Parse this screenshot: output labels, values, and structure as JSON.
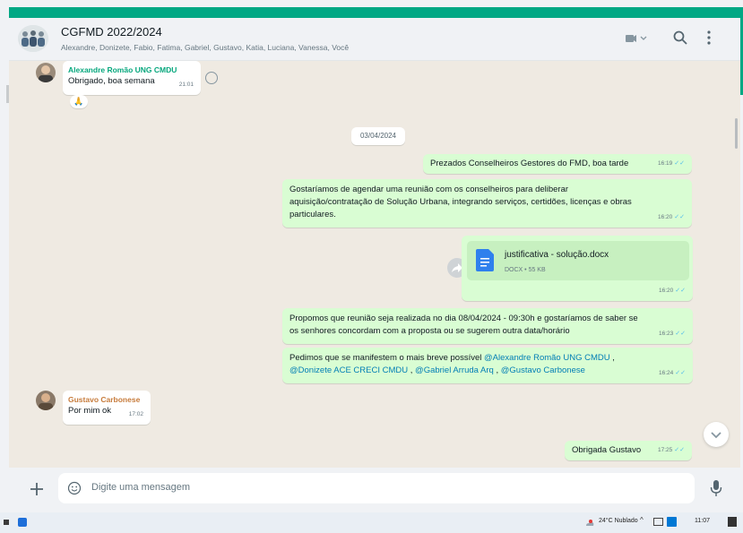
{
  "header": {
    "title": "CGFMD 2022/2024",
    "members": "Alexandre, Donizete, Fabio, Fatima, Gabriel, Gustavo, Katia, Luciana, Vanessa, Você",
    "icons": [
      "video-call-icon",
      "search-icon",
      "menu-icon"
    ]
  },
  "messages": [
    {
      "sender": "Alexandre Romão UNG CMDU",
      "sender_color": "#06a77d",
      "text": "Obrigado, boa semana",
      "time": "21:01",
      "direction": "in",
      "reaction": "🙏"
    },
    {
      "date": "03/04/2024"
    },
    {
      "text": "Prezados Conselheiros Gestores do FMD, boa tarde",
      "time": "16:19",
      "direction": "out"
    },
    {
      "text": "Gostaríamos de agendar uma reunião com os conselheiros para deliberar\naquisição/contratação de Solução Urbana, integrando serviços, certidões, licenças e obras\nparticulares.",
      "time": "16:20",
      "direction": "out"
    },
    {
      "doc_name": "justificativa - solução.docx",
      "doc_meta": "DOCX • 55 KB",
      "time": "16:20",
      "direction": "out"
    },
    {
      "text": "Propomos que reunião seja realizada no dia 08/04/2024 - 09:30h e gostaríamos de saber se\nos senhores concordam com a proposta ou se sugerem outra data/horário",
      "time": "16:23",
      "direction": "out"
    },
    {
      "text_prefix": "Pedimos que se manifestem o mais breve possível",
      "mentions": [
        "@Alexandre Romão UNG CMDU",
        "@Donizete ACE CRECI CMDU",
        "@Gabriel Arruda Arq",
        "@Gustavo Carbonese"
      ],
      "time": "16:24",
      "direction": "out"
    },
    {
      "sender": "Gustavo Carbonese",
      "sender_color": "#c77b3b",
      "text": "Por mim ok",
      "time": "17:02",
      "direction": "in"
    },
    {
      "text": "Obrigada Gustavo",
      "time": "17:25",
      "direction": "out"
    }
  ],
  "composer": {
    "placeholder": "Digite uma mensagem"
  },
  "taskbar": {
    "weather": "24°C Nublado",
    "clock": "11:07"
  },
  "colors": {
    "accent": "#00a884",
    "outgoing_bubble": "#d9fdd3",
    "incoming_bubble": "#ffffff",
    "chat_background": "#efeae2",
    "read_ticks": "#53bdeb",
    "mention": "#027eb5"
  }
}
